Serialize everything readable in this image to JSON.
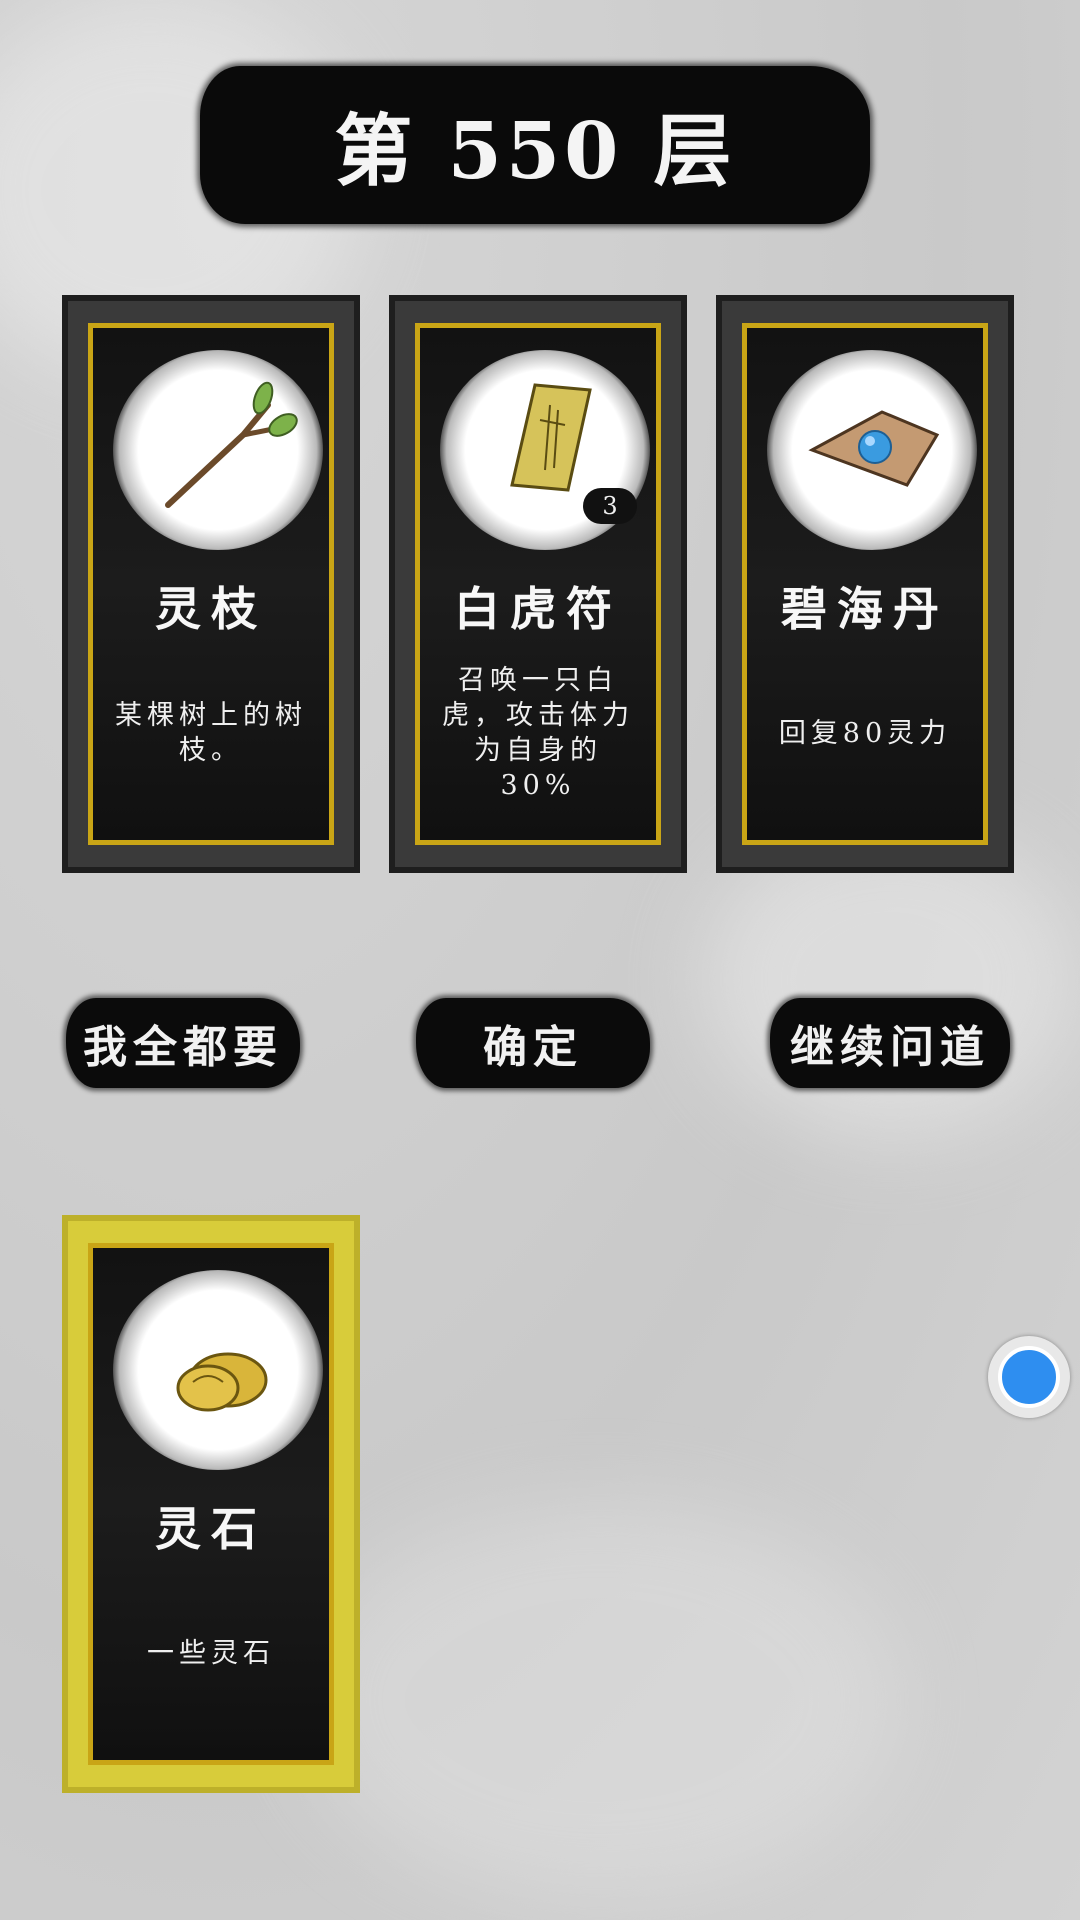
{
  "floor": {
    "title": "第 550 层"
  },
  "reward_cards": [
    {
      "name": "灵枝",
      "description": "某棵树上的树枝。",
      "icon": "branch-icon",
      "count": null,
      "selected": false
    },
    {
      "name": "白虎符",
      "description": "召唤一只白虎，攻击体力为自身的30%",
      "icon": "talisman-icon",
      "count": "3",
      "selected": false
    },
    {
      "name": "碧海丹",
      "description": "回复80灵力",
      "icon": "pill-icon",
      "count": null,
      "selected": false
    }
  ],
  "buttons": {
    "take_all": "我全都要",
    "confirm": "确定",
    "continue": "继续问道"
  },
  "selected_items": [
    {
      "name": "灵石",
      "description": "一些灵石",
      "icon": "spirit-stone-icon",
      "selected": true
    }
  ],
  "colors": {
    "card_gold": "#c9a516",
    "selected_frame": "#d8cc3a",
    "ink": "#0b0b0b",
    "float_ball": "#2e8ef0"
  }
}
